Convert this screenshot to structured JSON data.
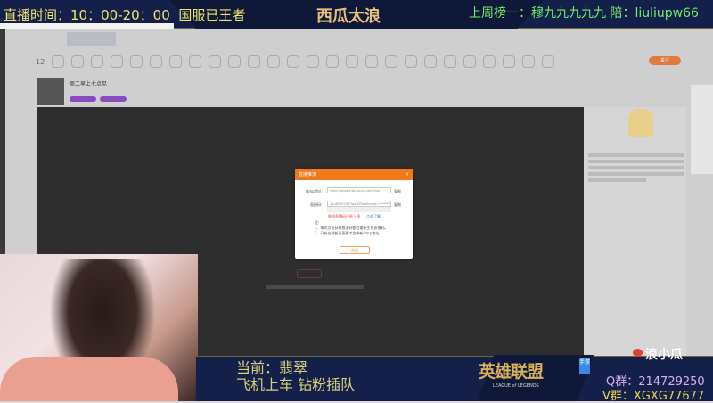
{
  "overlay": {
    "live_time": "直播时间：10：00-20：00",
    "server": "国服已王者",
    "streamer_title": "西瓜太浪",
    "weekly_top": "上周榜一：穆九九九九九",
    "companion": "陪：liuliupw66",
    "current": "当前：翡翠",
    "queue_note": "飞机上车 钻粉插队",
    "game_logo_cn": "英雄联盟",
    "game_logo_en": "LEAGUE of LEGENDS",
    "game_badge": "手游",
    "weibo_name": "浪小瓜",
    "qq_group": "Q群：214729250",
    "v_group": "V群：XGXG77677"
  },
  "page": {
    "level": "12",
    "streamer_name": "周二早上七点见",
    "follow_label": "关注",
    "dialog": {
      "title": "直播推流",
      "rtmp_label": "rtmp地址:",
      "rtmp_value": "rtmp://sendtc3a.douyu.com/live",
      "key_label": "直播码:",
      "key_value": "11483057wTYpXD0?wsSecret=********",
      "copy_label": "复制",
      "warn": "推流直播码已经上线",
      "link": "点此了解",
      "notes_title": "注:",
      "note1": "1、每次点击获取推流码都会重新生成直播码。",
      "note2": "2、只有在刷新后直播才会带新rtmp地址。",
      "ok_label": "关闭"
    }
  }
}
